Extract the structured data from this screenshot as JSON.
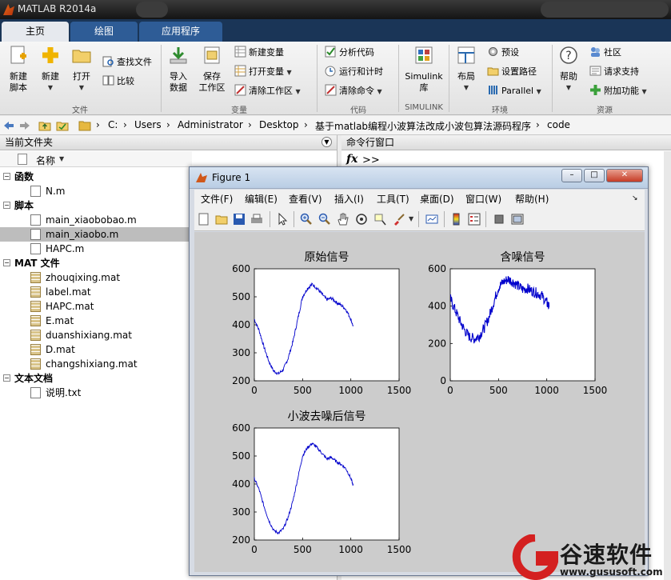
{
  "app": {
    "title": "MATLAB R2014a"
  },
  "tabs": [
    {
      "label": "主页",
      "active": true
    },
    {
      "label": "绘图",
      "active": false
    },
    {
      "label": "应用程序",
      "active": false
    }
  ],
  "ribbon": {
    "file_group": {
      "new_script": "新建\n脚本",
      "new_script_l1": "新建",
      "new_script_l2": "脚本",
      "new": "新建",
      "open": "打开",
      "find_files": "查找文件",
      "compare": "比较",
      "label": "文件"
    },
    "variable_group": {
      "import_l1": "导入",
      "import_l2": "数据",
      "save_l1": "保存",
      "save_l2": "工作区",
      "new_var": "新建变量",
      "open_var": "打开变量",
      "clear_ws": "清除工作区",
      "label": "变量"
    },
    "code_group": {
      "analyze": "分析代码",
      "run_time": "运行和计时",
      "clear_cmd": "清除命令",
      "label": "代码"
    },
    "simulink_group": {
      "simulink_l1": "Simulink",
      "simulink_l2": "库",
      "label": "SIMULINK"
    },
    "env_group": {
      "layout": "布局",
      "prefs": "预设",
      "set_path": "设置路径",
      "parallel": "Parallel",
      "label": "环境"
    },
    "resources_group": {
      "help": "帮助",
      "community": "社区",
      "support": "请求支持",
      "addons": "附加功能",
      "label": "资源"
    }
  },
  "address": {
    "crumbs": [
      "C:",
      "Users",
      "Administrator",
      "Desktop",
      "基于matlab编程小波算法改成小波包算法源码程序",
      "code"
    ]
  },
  "current_folder": {
    "title": "当前文件夹",
    "column": "名称",
    "groups": [
      {
        "label": "函数",
        "items": [
          "N.m"
        ]
      },
      {
        "label": "脚本",
        "items": [
          "main_xiaobobao.m",
          "main_xiaobo.m",
          "HAPC.m"
        ]
      },
      {
        "label": "MAT 文件",
        "items": [
          "zhouqixing.mat",
          "label.mat",
          "HAPC.mat",
          "E.mat",
          "duanshixiang.mat",
          "D.mat",
          "changshixiang.mat"
        ]
      },
      {
        "label": "文本文档",
        "items": [
          "说明.txt"
        ]
      }
    ],
    "selected": "main_xiaobo.m"
  },
  "command_window": {
    "title": "命令行窗口",
    "fx": "fx",
    "prompt": ">>"
  },
  "figure": {
    "title": "Figure 1",
    "menu": [
      "文件(F)",
      "编辑(E)",
      "查看(V)",
      "插入(I)",
      "工具(T)",
      "桌面(D)",
      "窗口(W)",
      "帮助(H)"
    ]
  },
  "colors": {
    "plot_line": "#0000cc",
    "tab_active_bg": "#e6e9ee",
    "tab_bar": "#1a3557",
    "watermark_red": "#d42020"
  },
  "watermark": {
    "brand": "谷速软件",
    "url": "www.gususoft.com"
  },
  "chart_data": [
    {
      "type": "line",
      "title": "原始信号",
      "xlim": [
        0,
        1500
      ],
      "ylim": [
        200,
        600
      ],
      "xticks": [
        0,
        500,
        1000,
        1500
      ],
      "yticks": [
        200,
        300,
        400,
        500,
        600
      ],
      "x": [
        0,
        50,
        100,
        150,
        200,
        250,
        300,
        350,
        400,
        450,
        500,
        550,
        600,
        650,
        700,
        750,
        800,
        850,
        900,
        950,
        1000,
        1024
      ],
      "y": [
        420,
        380,
        320,
        270,
        235,
        225,
        240,
        280,
        340,
        420,
        500,
        530,
        545,
        530,
        510,
        490,
        495,
        480,
        470,
        455,
        420,
        395
      ],
      "noise": 6
    },
    {
      "type": "line",
      "title": "含噪信号",
      "xlim": [
        0,
        1500
      ],
      "ylim": [
        0,
        600
      ],
      "xticks": [
        0,
        500,
        1000,
        1500
      ],
      "yticks": [
        0,
        200,
        400,
        600
      ],
      "x": [
        0,
        50,
        100,
        150,
        200,
        250,
        300,
        350,
        400,
        450,
        500,
        550,
        600,
        650,
        700,
        750,
        800,
        850,
        900,
        950,
        1000,
        1024
      ],
      "y": [
        440,
        380,
        320,
        270,
        235,
        225,
        240,
        280,
        340,
        420,
        500,
        530,
        545,
        530,
        510,
        490,
        495,
        480,
        470,
        455,
        420,
        395
      ],
      "noise": 28
    },
    {
      "type": "line",
      "title": "小波去噪后信号",
      "xlim": [
        0,
        1500
      ],
      "ylim": [
        200,
        600
      ],
      "xticks": [
        0,
        500,
        1000,
        1500
      ],
      "yticks": [
        200,
        300,
        400,
        500,
        600
      ],
      "x": [
        0,
        50,
        100,
        150,
        200,
        250,
        300,
        350,
        400,
        450,
        500,
        550,
        600,
        650,
        700,
        750,
        800,
        850,
        900,
        950,
        1000,
        1024
      ],
      "y": [
        420,
        380,
        320,
        270,
        235,
        225,
        240,
        280,
        340,
        420,
        500,
        530,
        545,
        530,
        510,
        490,
        495,
        480,
        470,
        455,
        420,
        395
      ],
      "noise": 5
    }
  ]
}
